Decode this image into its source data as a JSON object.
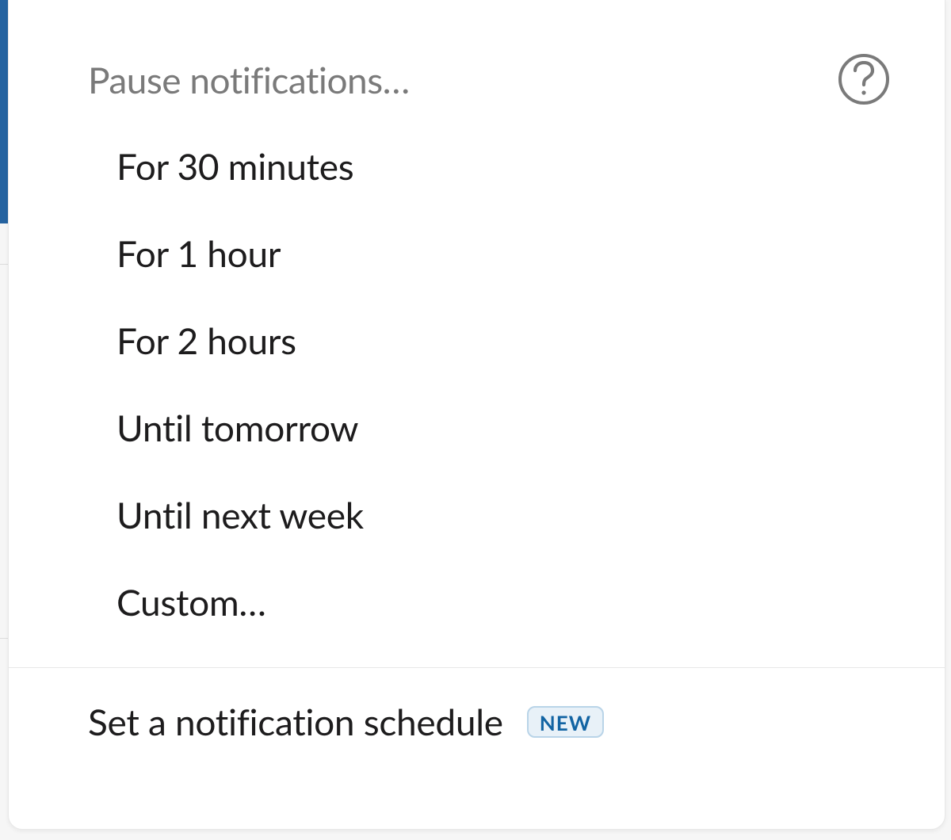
{
  "header": {
    "title": "Pause notifications…"
  },
  "items": [
    {
      "label": "For 30 minutes"
    },
    {
      "label": "For 1 hour"
    },
    {
      "label": "For 2 hours"
    },
    {
      "label": "Until tomorrow"
    },
    {
      "label": "Until next week"
    },
    {
      "label": "Custom…"
    }
  ],
  "footer": {
    "label": "Set a notification schedule",
    "badge": "NEW"
  }
}
